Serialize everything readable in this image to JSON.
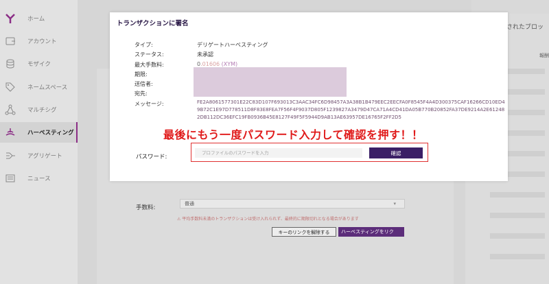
{
  "sidebar": {
    "items": [
      {
        "label": "ホーム",
        "icon": "y-logo-icon"
      },
      {
        "label": "アカウント",
        "icon": "account-icon"
      },
      {
        "label": "モザイク",
        "icon": "coins-icon"
      },
      {
        "label": "ネームスペース",
        "icon": "tag-icon"
      },
      {
        "label": "マルチシグ",
        "icon": "network-icon"
      },
      {
        "label": "ハーベスティング",
        "icon": "harvest-icon",
        "active": true
      },
      {
        "label": "アグリゲート",
        "icon": "aggregate-icon"
      },
      {
        "label": "ニュース",
        "icon": "news-icon"
      }
    ]
  },
  "background": {
    "right_panel_title": "されたブロッ",
    "right_panel_header": "報酬",
    "fee_label": "手数料:",
    "fee_value": "普通",
    "warning": "⚠ 平均手数料未満のトランザクションは受け入れられず、最終的に期限切れとなる場合があります",
    "unlink_button": "キーのリンクを解除する",
    "harvest_button": "ハーベスティングをリク"
  },
  "modal": {
    "title": "トランザクションに署名",
    "type_label": "タイプ:",
    "type_value": "デリゲートハーベスティング",
    "status_label": "ステータス:",
    "status_value": "未承認",
    "maxfee_label": "最大手数料:",
    "maxfee_zero": "0",
    "maxfee_num": ".01606",
    "maxfee_unit": "(XYM)",
    "deadline_label": "期限:",
    "sender_label": "送信者:",
    "recipient_label": "宛先:",
    "message_label": "メッセージ:",
    "message_value": "FE2A8061577301E22C83D107F693013C3AAC34FC6D98457A3A38B1B479EEC2EECFA0F8545F4A4D300375CAF16266CD10ED49B72C1E97D778511D8F83E8FEA7F56F4F9037D805F1239827A3479D47CA71A4CD41DA05B770B20852FA37DE9214A2E612482DB112DC36EFC19FB0936B45E8127F49F5F5944D9AB13AE63957DE16765F2FF2D5",
    "password_label": "パスワード:",
    "password_placeholder": "プロファイルのパスワードを入力",
    "confirm_button": "確認"
  },
  "annotation": "最後にもう一度パスワード入力して確認を押す！！",
  "colors": {
    "accent": "#3b1f66",
    "active_border": "#8b2d86",
    "annotation": "#e01a1a"
  }
}
